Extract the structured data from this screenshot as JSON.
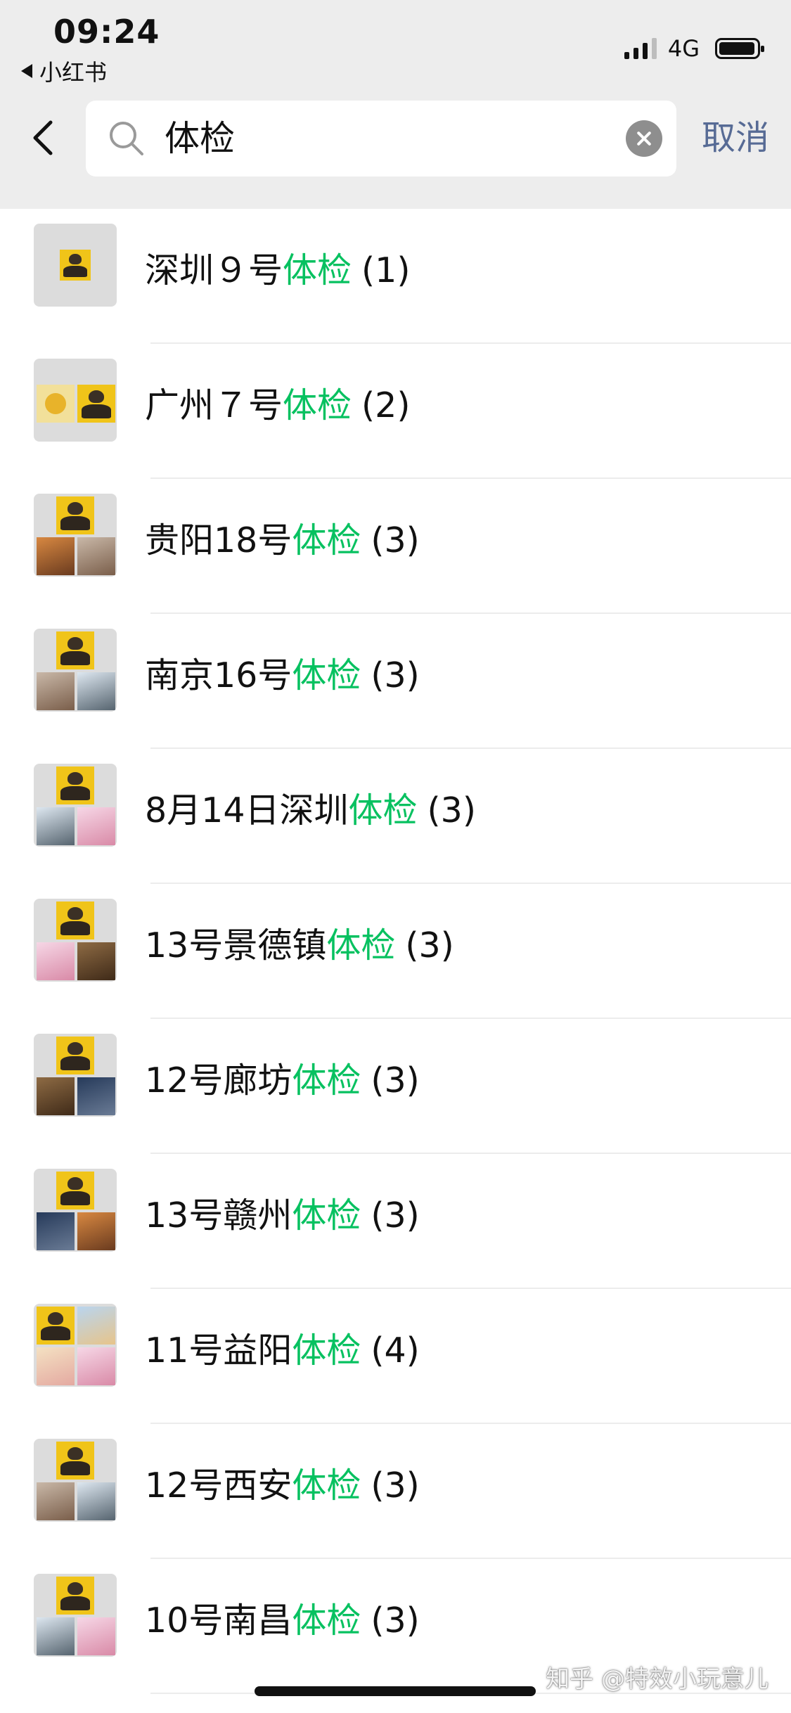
{
  "status_bar": {
    "time": "09:24",
    "back_app": "小红书",
    "network": "4G"
  },
  "search": {
    "query": "体检",
    "cancel_label": "取消"
  },
  "results": [
    {
      "prefix": "深圳９号",
      "highlight": "体检",
      "count": "(1)",
      "avatar": "single"
    },
    {
      "prefix": "广州７号",
      "highlight": "体检",
      "count": "(2)",
      "avatar": "two"
    },
    {
      "prefix": "贵阳18号",
      "highlight": "体检",
      "count": "(3)",
      "avatar": "three"
    },
    {
      "prefix": "南京16号",
      "highlight": "体检",
      "count": "(3)",
      "avatar": "three"
    },
    {
      "prefix": "8月14日深圳",
      "highlight": "体检",
      "count": "(3)",
      "avatar": "three"
    },
    {
      "prefix": "13号景德镇",
      "highlight": "体检",
      "count": "(3)",
      "avatar": "three"
    },
    {
      "prefix": "12号廊坊",
      "highlight": "体检",
      "count": "(3)",
      "avatar": "three"
    },
    {
      "prefix": "13号赣州",
      "highlight": "体检",
      "count": "(3)",
      "avatar": "three"
    },
    {
      "prefix": "11号益阳",
      "highlight": "体检",
      "count": "(4)",
      "avatar": "four"
    },
    {
      "prefix": "12号西安",
      "highlight": "体检",
      "count": "(3)",
      "avatar": "three"
    },
    {
      "prefix": "10号南昌",
      "highlight": "体检",
      "count": "(3)",
      "avatar": "three"
    }
  ],
  "watermark": "知乎 @特效小玩意儿",
  "colors": {
    "highlight": "#07c160",
    "cancel": "#576b95",
    "header_bg": "#ededed"
  }
}
